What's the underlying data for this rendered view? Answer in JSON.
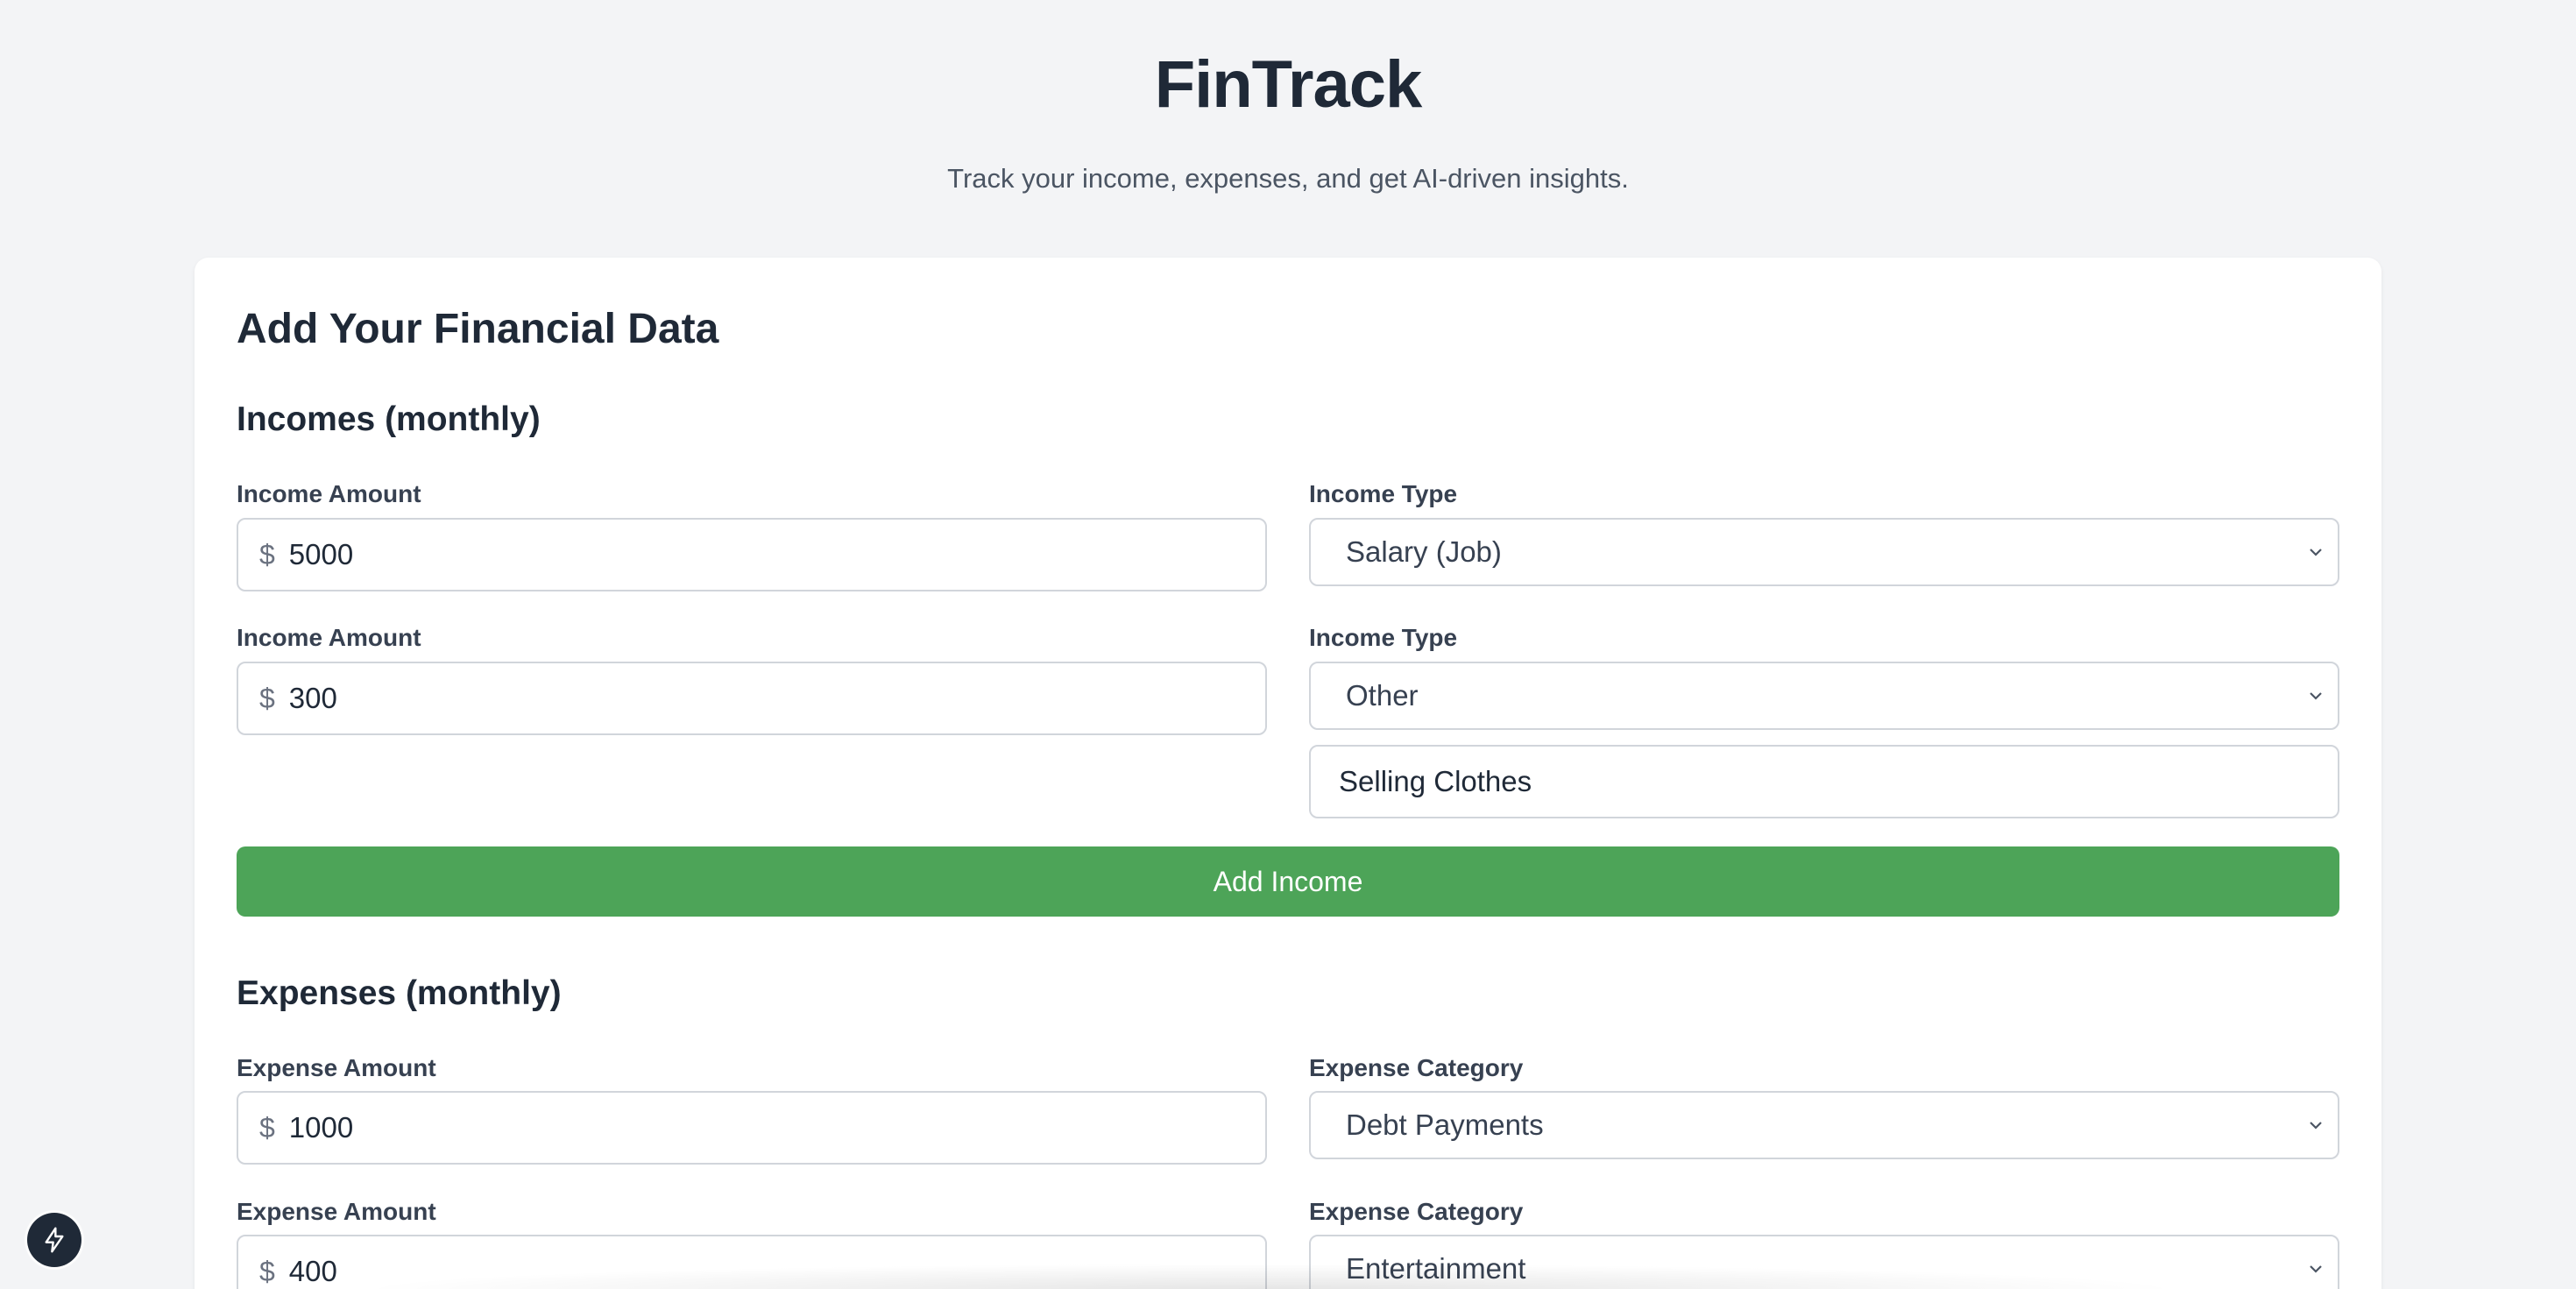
{
  "header": {
    "title": "FinTrack",
    "subtitle": "Track your income, expenses, and get AI-driven insights."
  },
  "form": {
    "title": "Add Your Financial Data",
    "incomes": {
      "section_title": "Incomes (monthly)",
      "amount_label": "Income Amount",
      "type_label": "Income Type",
      "currency_symbol": "$",
      "rows": [
        {
          "amount": "5000",
          "type": "Salary (Job)"
        },
        {
          "amount": "300",
          "type": "Other",
          "other_description": "Selling Clothes"
        }
      ],
      "add_button_label": "Add Income"
    },
    "expenses": {
      "section_title": "Expenses (monthly)",
      "amount_label": "Expense Amount",
      "category_label": "Expense Category",
      "currency_symbol": "$",
      "rows": [
        {
          "amount": "1000",
          "category": "Debt Payments"
        },
        {
          "amount": "400",
          "category": "Entertainment"
        }
      ]
    }
  },
  "colors": {
    "background": "#f3f4f6",
    "card": "#ffffff",
    "primary_button": "#4da458",
    "text_dark": "#1f2937"
  },
  "icons": {
    "select_arrow": "chevron-down-icon",
    "floating_button": "lightning-bolt-icon"
  }
}
